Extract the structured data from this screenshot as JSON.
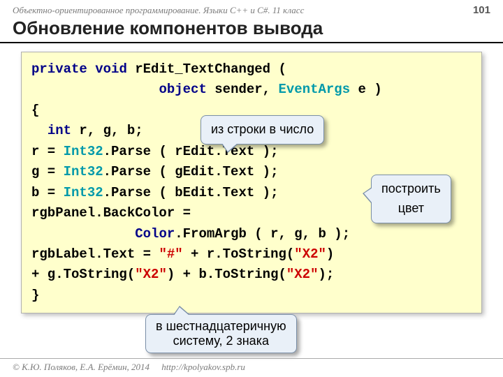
{
  "header": {
    "course": "Объектно-ориентированное программирование. Языки C++ и C#. 11 класс",
    "page": "101"
  },
  "title": "Обновление компонентов вывода",
  "code": {
    "l1a": "private",
    "l1b": "void",
    "l1c": "rEdit_TextChanged",
    "l1d": " (",
    "l2a": "object",
    "l2b": " sender, ",
    "l2c": "EventArgs",
    "l2d": " e )",
    "l3": "{",
    "l4a": "int",
    "l4b": " r, g, b;",
    "l5a": "  r = ",
    "l5b": "Int32",
    "l5c": ".Parse ( rEdit.Text );",
    "l6a": "  g = ",
    "l6b": "Int32",
    "l6c": ".Parse ( gEdit.Text );",
    "l7a": "  b = ",
    "l7b": "Int32",
    "l7c": ".Parse ( bEdit.Text );",
    "l8": "  rgbPanel.BackColor =",
    "l9a": "Color",
    "l9b": ".FromArgb ( r, g, b );",
    "l10a": "  rgbLabel.Text = ",
    "l10b": "\"#\"",
    "l10c": " + r.ToString(",
    "l10d": "\"X2\"",
    "l10e": ")",
    "l11a": "  + g.ToString(",
    "l11b": "\"X2\"",
    "l11c": ") + b.ToString(",
    "l11d": "\"X2\"",
    "l11e": ");",
    "l12": "}"
  },
  "callouts": {
    "c1": "из строки в число",
    "c2a": "построить",
    "c2b": "цвет",
    "c3a": "в шестнадцатеричную",
    "c3b": "систему, 2 знака"
  },
  "footer": {
    "copyright": "© К.Ю. Поляков, Е.А. Ерёмин, 2014",
    "url": "http://kpolyakov.spb.ru"
  }
}
